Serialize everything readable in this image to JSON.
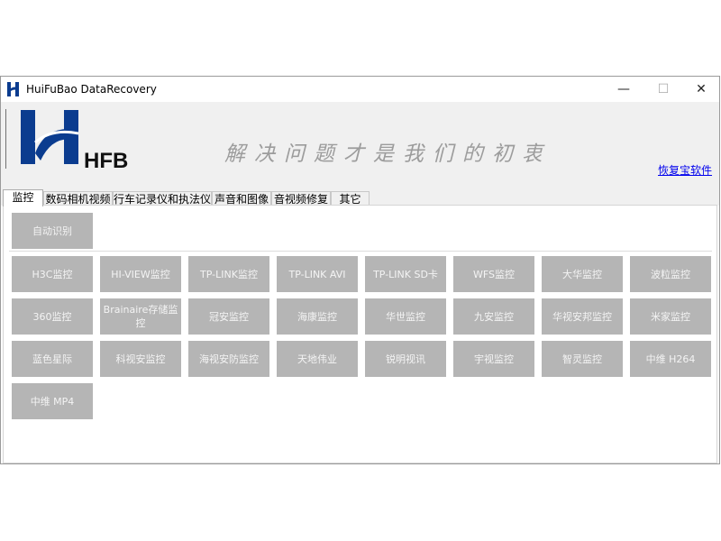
{
  "window": {
    "title": "HuiFuBao DataRecovery",
    "controls": {
      "minimize": "—",
      "maximize": "☐",
      "close": "✕"
    }
  },
  "header": {
    "logo_text": "HFB",
    "slogan": "解决问题才是我们的初衷",
    "company_link": "恢复宝软件",
    "brand_color": "#0b3c8f"
  },
  "tabs": [
    "监控",
    "数码相机视频",
    "行车记录仪和执法仪",
    "声音和图像",
    "音视频修复",
    "其它"
  ],
  "active_tab": "监控",
  "auto_button": "自动识别",
  "buttons": [
    "H3C监控",
    "HI-VIEW监控",
    "TP-LINK监控",
    "TP-LINK AVI",
    "TP-LINK SD卡",
    "WFS监控",
    "大华监控",
    "波粒监控",
    "360监控",
    "Brainaire存储监控",
    "冠安监控",
    "海康监控",
    "华世监控",
    "九安监控",
    "华视安邦监控",
    "米家监控",
    "蓝色星际",
    "科视安监控",
    "海视安防监控",
    "天地伟业",
    "锐明视讯",
    "宇视监控",
    "智灵监控",
    "中维 H264",
    "中维 MP4"
  ],
  "colors": {
    "button_bg": "#b5b5b5",
    "button_text": "#f4f4f4",
    "link": "#0000ee"
  }
}
